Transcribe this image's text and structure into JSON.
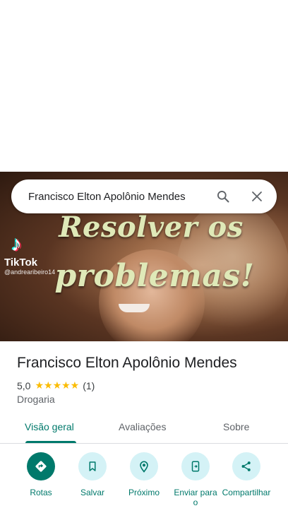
{
  "hero": {
    "overlay_line1": "Resolver os",
    "overlay_line2": "problemas!",
    "watermark_brand": "TikTok",
    "watermark_handle": "@andrearibeiro14"
  },
  "search": {
    "query": "Francisco Elton Apolônio Mendes",
    "icons": [
      "search-icon",
      "close-icon"
    ]
  },
  "place": {
    "title": "Francisco Elton Apolônio Mendes",
    "rating_value": "5,0",
    "stars": "★★★★★",
    "rating_fraction": 1.0,
    "review_count": "(1)",
    "category": "Drogaria"
  },
  "tabs": [
    {
      "label": "Visão geral",
      "active": true
    },
    {
      "label": "Avaliações",
      "active": false
    },
    {
      "label": "Sobre",
      "active": false
    }
  ],
  "actions": [
    {
      "label": "Rotas",
      "icon": "directions-icon"
    },
    {
      "label": "Salvar",
      "icon": "bookmark-icon"
    },
    {
      "label": "Próximo",
      "icon": "nearby-icon"
    },
    {
      "label": "Enviar para o",
      "icon": "send-to-phone-icon"
    },
    {
      "label": "Compartilhar",
      "icon": "share-icon"
    }
  ],
  "colors": {
    "accent": "#00796b",
    "action_bg": "#d4f2f6",
    "star": "#fbbc04"
  }
}
